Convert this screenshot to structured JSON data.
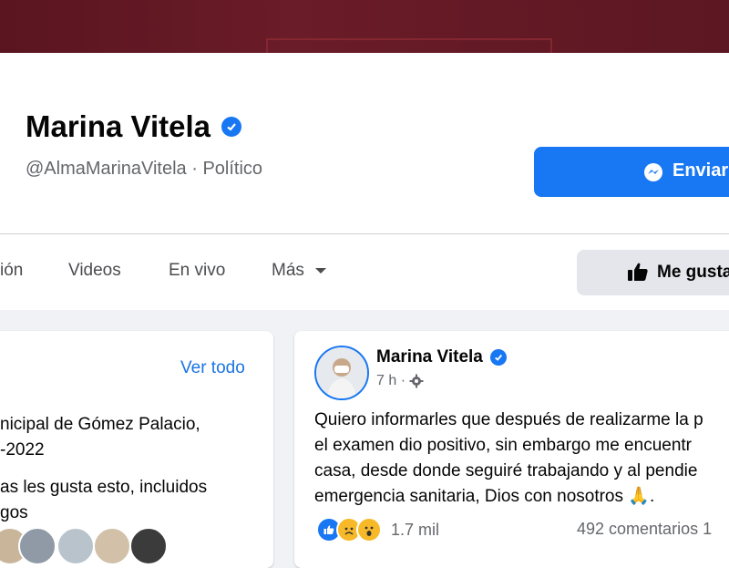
{
  "profile": {
    "name": "Marina Vitela",
    "subline": "@AlmaMarinaVitela · Político",
    "send_button": "Enviar",
    "like_button": "Me gusta"
  },
  "tabs": [
    "ión",
    "Videos",
    "En vivo",
    "Más"
  ],
  "about_card": {
    "see_all": "Ver todo",
    "line1": "nicipal de Gómez Palacio,",
    "line2": "-2022",
    "line3": "as les gusta esto, incluidos",
    "line4": "gos"
  },
  "post": {
    "author": "Marina Vitela",
    "time": "7 h ·",
    "body": [
      "Quiero informarles que después de realizarme la p",
      "el examen dio positivo, sin embargo me encuentr",
      "casa, desde donde seguiré trabajando y al pendie",
      "emergencia sanitaria, Dios con nosotros 🙏."
    ],
    "reaction_count": "1.7 mil",
    "comments": "492 comentarios  1"
  },
  "colors": {
    "brand": "#1877f2",
    "cover": "#5e1a24"
  },
  "icons": [
    "verified-badge-icon",
    "messenger-icon",
    "dropdown-caret-icon",
    "thumbs-up-icon",
    "settings-gear-icon",
    "like-reaction-icon",
    "sad-reaction-icon",
    "wow-reaction-icon"
  ]
}
